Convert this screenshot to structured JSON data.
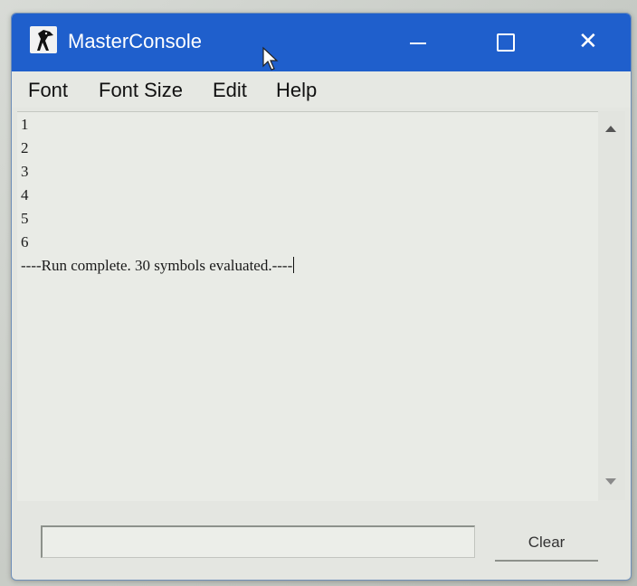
{
  "window": {
    "title": "MasterConsole",
    "icon": "penguin-icon",
    "controls": [
      "minimize-icon",
      "maximize-icon",
      "close-icon"
    ]
  },
  "menu": {
    "items": [
      "Font",
      "Font Size",
      "Edit",
      "Help"
    ]
  },
  "console": {
    "lines": [
      "1",
      "2",
      "3",
      "4",
      "5",
      "6",
      "----Run complete.  30 symbols evaluated.----"
    ]
  },
  "input": {
    "value": ""
  },
  "clear_button": {
    "label": "Clear"
  },
  "colors": {
    "titlebar": "#1f5fcc",
    "console_bg": "#e9ebe6"
  }
}
